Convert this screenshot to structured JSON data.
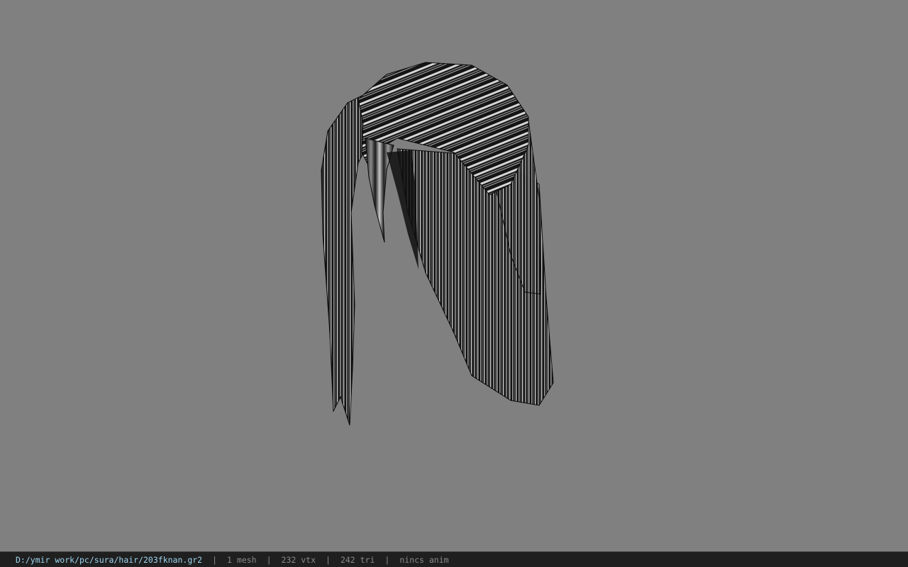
{
  "viewport": {
    "background": "#808080",
    "model_icon": "hair-mesh"
  },
  "status": {
    "path": "D:/ymir work/pc/sura/hair/203fknan.gr2",
    "mesh": "1 mesh",
    "vtx": "232 vtx",
    "tri": "242 tri",
    "anim": "nincs anim",
    "separator": "|"
  }
}
